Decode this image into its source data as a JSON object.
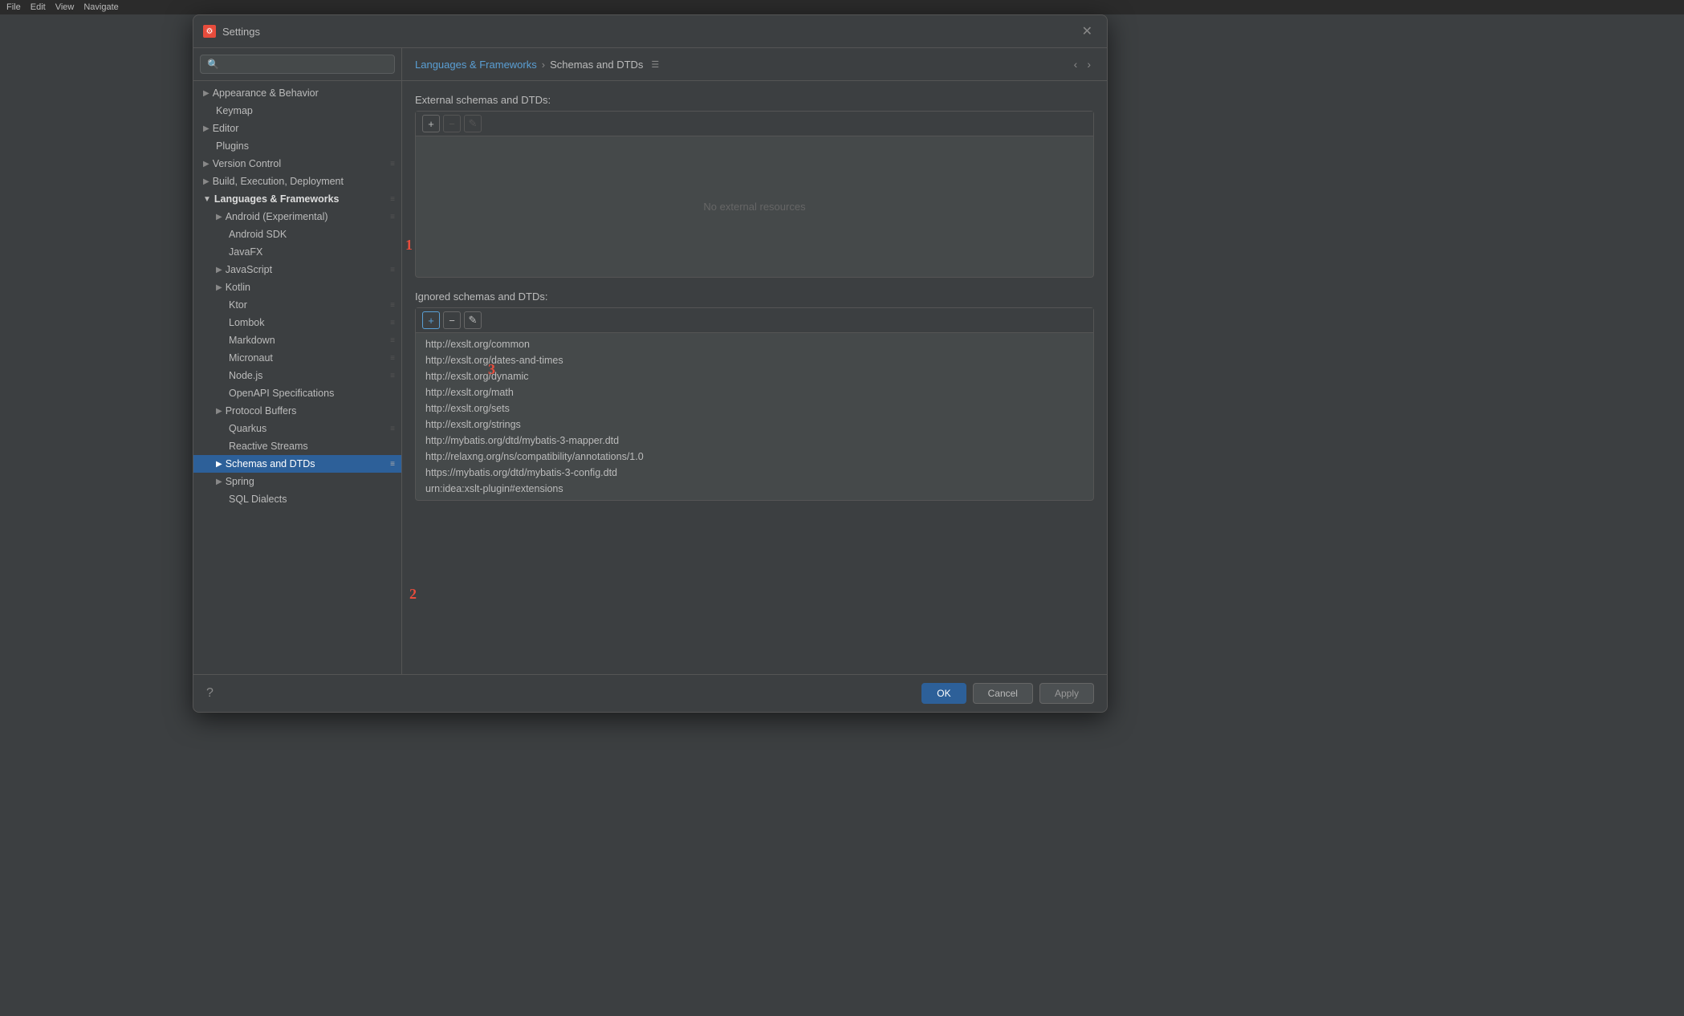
{
  "dialog": {
    "title": "Settings",
    "close_label": "✕"
  },
  "search": {
    "placeholder": "🔍"
  },
  "sidebar": {
    "items": [
      {
        "id": "appearance",
        "label": "Appearance & Behavior",
        "level": 0,
        "has_arrow": true,
        "bold": false
      },
      {
        "id": "keymap",
        "label": "Keymap",
        "level": 0,
        "has_arrow": false,
        "bold": false
      },
      {
        "id": "editor",
        "label": "Editor",
        "level": 0,
        "has_arrow": true,
        "bold": false
      },
      {
        "id": "plugins",
        "label": "Plugins",
        "level": 0,
        "has_arrow": false,
        "bold": false
      },
      {
        "id": "version-control",
        "label": "Version Control",
        "level": 0,
        "has_arrow": true,
        "bold": false
      },
      {
        "id": "build",
        "label": "Build, Execution, Deployment",
        "level": 0,
        "has_arrow": true,
        "bold": false
      },
      {
        "id": "languages",
        "label": "Languages & Frameworks",
        "level": 0,
        "has_arrow": true,
        "bold": true,
        "open": true
      },
      {
        "id": "android-experimental",
        "label": "Android (Experimental)",
        "level": 1,
        "has_arrow": true,
        "bold": false
      },
      {
        "id": "android-sdk",
        "label": "Android SDK",
        "level": 1,
        "has_arrow": false,
        "bold": false
      },
      {
        "id": "javafx",
        "label": "JavaFX",
        "level": 1,
        "has_arrow": false,
        "bold": false
      },
      {
        "id": "javascript",
        "label": "JavaScript",
        "level": 1,
        "has_arrow": true,
        "bold": false
      },
      {
        "id": "kotlin",
        "label": "Kotlin",
        "level": 1,
        "has_arrow": true,
        "bold": false
      },
      {
        "id": "ktor",
        "label": "Ktor",
        "level": 1,
        "has_arrow": false,
        "bold": false
      },
      {
        "id": "lombok",
        "label": "Lombok",
        "level": 1,
        "has_arrow": false,
        "bold": false
      },
      {
        "id": "markdown",
        "label": "Markdown",
        "level": 1,
        "has_arrow": false,
        "bold": false
      },
      {
        "id": "micronaut",
        "label": "Micronaut",
        "level": 1,
        "has_arrow": false,
        "bold": false
      },
      {
        "id": "nodejs",
        "label": "Node.js",
        "level": 1,
        "has_arrow": false,
        "bold": false
      },
      {
        "id": "openapi",
        "label": "OpenAPI Specifications",
        "level": 1,
        "has_arrow": false,
        "bold": false
      },
      {
        "id": "protocol-buffers",
        "label": "Protocol Buffers",
        "level": 1,
        "has_arrow": true,
        "bold": false
      },
      {
        "id": "quarkus",
        "label": "Quarkus",
        "level": 1,
        "has_arrow": false,
        "bold": false
      },
      {
        "id": "reactive-streams",
        "label": "Reactive Streams",
        "level": 1,
        "has_arrow": false,
        "bold": false
      },
      {
        "id": "schemas-dtds",
        "label": "Schemas and DTDs",
        "level": 1,
        "has_arrow": true,
        "bold": false,
        "selected": true
      },
      {
        "id": "spring",
        "label": "Spring",
        "level": 1,
        "has_arrow": true,
        "bold": false
      },
      {
        "id": "sql-dialects",
        "label": "SQL Dialects",
        "level": 1,
        "has_arrow": false,
        "bold": false
      }
    ]
  },
  "breadcrumb": {
    "parent": "Languages & Frameworks",
    "separator": "›",
    "current": "Schemas and DTDs",
    "menu_icon": "☰"
  },
  "external_schemas": {
    "title": "External schemas and DTDs:",
    "empty_text": "No external resources",
    "toolbar": {
      "add_label": "+",
      "remove_label": "−",
      "edit_label": "✎"
    },
    "items": []
  },
  "ignored_schemas": {
    "title": "Ignored schemas and DTDs:",
    "toolbar": {
      "add_label": "+",
      "remove_label": "−",
      "edit_label": "✎"
    },
    "items": [
      "http://exslt.org/common",
      "http://exslt.org/dates-and-times",
      "http://exslt.org/dynamic",
      "http://exslt.org/math",
      "http://exslt.org/sets",
      "http://exslt.org/strings",
      "http://mybatis.org/dtd/mybatis-3-mapper.dtd",
      "http://relaxng.org/ns/compatibility/annotations/1.0",
      "https://mybatis.org/dtd/mybatis-3-config.dtd",
      "urn:idea:xslt-plugin#extensions"
    ]
  },
  "footer": {
    "help_label": "?",
    "ok_label": "OK",
    "cancel_label": "Cancel",
    "apply_label": "Apply"
  },
  "annotations": {
    "one": "1",
    "two": "2",
    "three": "3"
  }
}
